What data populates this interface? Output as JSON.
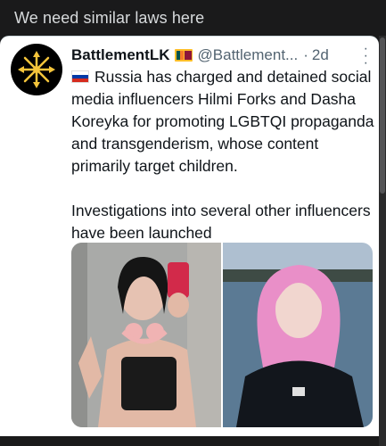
{
  "post": {
    "title": "We need similar laws here"
  },
  "tweet": {
    "display_name": "BattlementLK",
    "handle": "@Battlement...",
    "separator": "·",
    "time": "2d",
    "more_icon": "more-dots-icon",
    "paragraphs": [
      "Russia has charged and detained social media influencers Hilmi Forks and Dasha Koreyka for promoting LGBTQI propaganda and transgenderism, whose content primarily target children.",
      "Investigations into several other influencers have been launched"
    ],
    "images": [
      {
        "name": "selfie-photo",
        "caption": ""
      },
      {
        "name": "lakeside-portrait-photo",
        "caption": ""
      }
    ]
  },
  "colors": {
    "page_bg": "#1a1a1b",
    "card_bg": "#ffffff",
    "muted": "#536471",
    "text": "#0f1419"
  }
}
